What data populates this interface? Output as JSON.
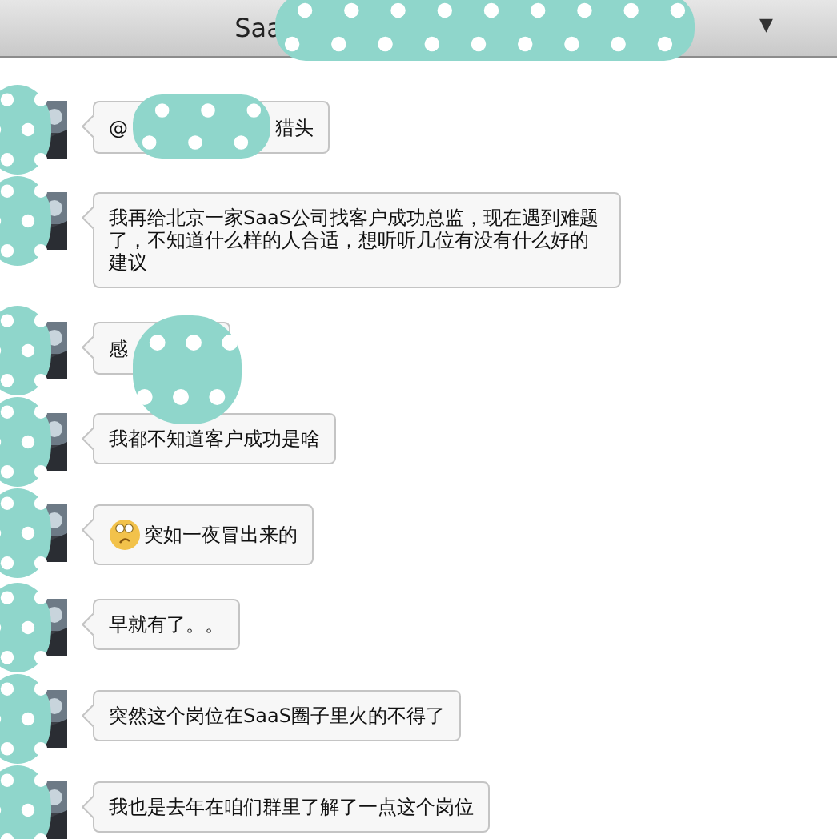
{
  "header": {
    "title_parts": [
      {
        "kind": "text",
        "text": "Saa"
      },
      {
        "kind": "redacted"
      }
    ],
    "menu_glyph": "▼"
  },
  "messages": [
    {
      "parts": [
        {
          "kind": "text",
          "text": "@"
        },
        {
          "kind": "redacted"
        },
        {
          "kind": "text",
          "text": "猎头"
        }
      ]
    },
    {
      "parts": [
        {
          "kind": "text",
          "text": "我再给北京一家SaaS公司找客户成功总监，现在遇到难题了，不知道什么样的人合适，想听听几位有没有什么好的建议"
        }
      ]
    },
    {
      "parts": [
        {
          "kind": "text",
          "text": "感"
        },
        {
          "kind": "redacted"
        }
      ]
    },
    {
      "parts": [
        {
          "kind": "text",
          "text": "我都不知道客户成功是啥"
        }
      ]
    },
    {
      "parts": [
        {
          "kind": "emoji"
        },
        {
          "kind": "text",
          "text": "突如一夜冒出来的"
        }
      ]
    },
    {
      "parts": [
        {
          "kind": "text",
          "text": "早就有了。。"
        }
      ]
    },
    {
      "parts": [
        {
          "kind": "text",
          "text": "突然这个岗位在SaaS圈子里火的不得了"
        }
      ]
    },
    {
      "parts": [
        {
          "kind": "text",
          "text": "我也是去年在咱们群里了解了一点这个岗位"
        }
      ]
    }
  ]
}
